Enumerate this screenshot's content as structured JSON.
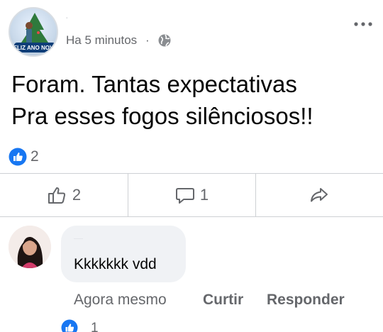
{
  "post": {
    "author_name": "·",
    "avatar_caption": "FELIZ ANO NOVO!",
    "timestamp": "Ha 5 minutos",
    "separator": "·",
    "privacy_icon": "globe-icon",
    "more_icon": "more-horizontal-icon",
    "text_line1": "Foram. Tantas expectativas",
    "text_line2": "Pra esses fogos silênciosos!!",
    "reaction_icon": "like-badge-icon",
    "reaction_count": "2"
  },
  "actions": {
    "like_count": "2",
    "comment_count": "1",
    "like_icon": "thumbs-up-icon",
    "comment_icon": "comment-icon",
    "share_icon": "share-icon"
  },
  "comment": {
    "author_name": "—",
    "text": "Kkkkkkk vdd",
    "time": "Agora mesmo",
    "like_label": "Curtir",
    "reply_label": "Responder",
    "reaction_count": "1"
  },
  "colors": {
    "facebook_blue": "#1877f2",
    "secondary_text": "#65676b",
    "bubble_bg": "#f0f2f5",
    "divider": "#ced0d4"
  }
}
